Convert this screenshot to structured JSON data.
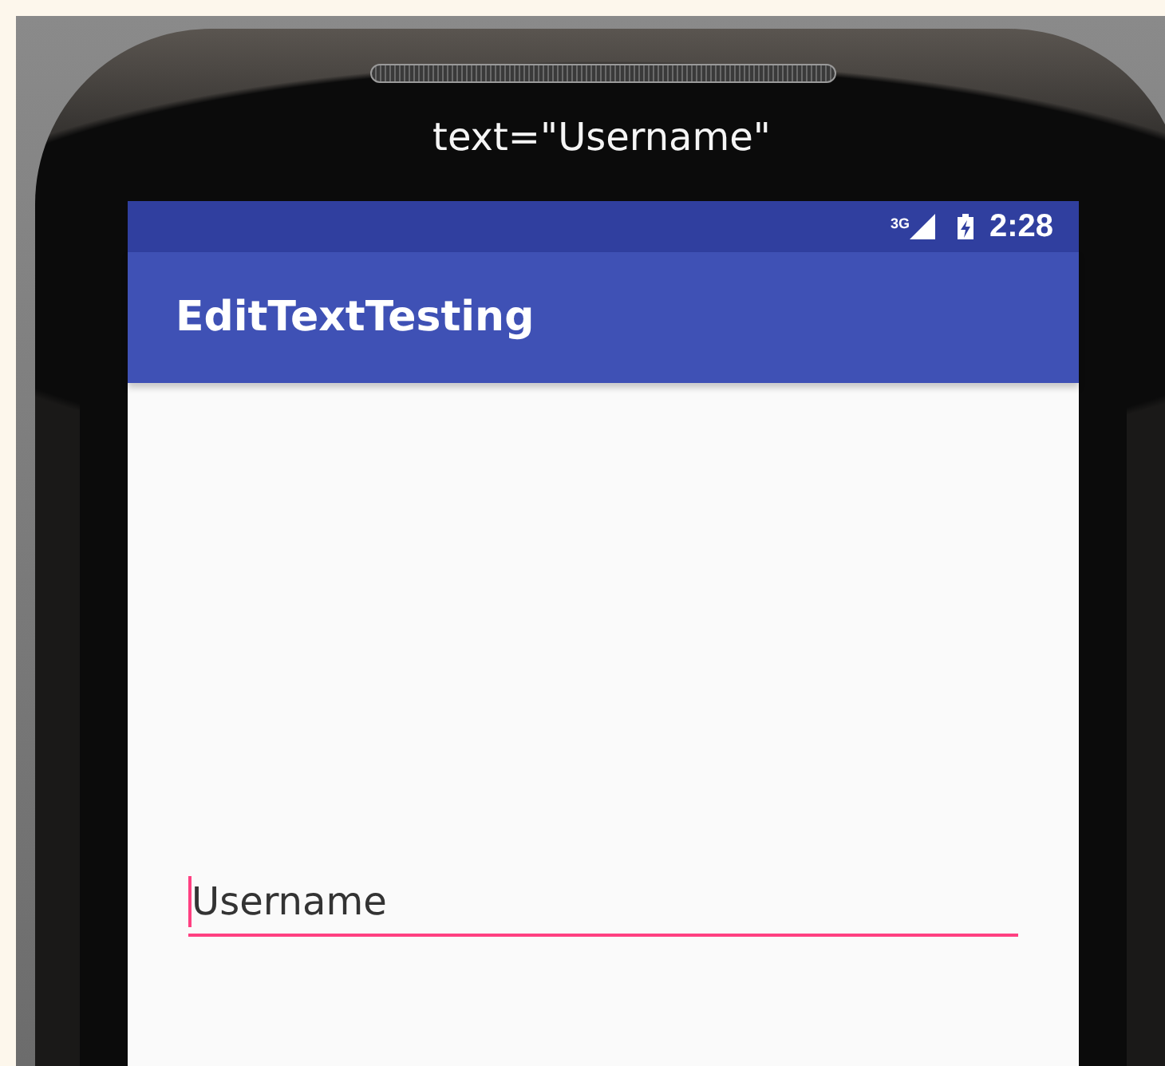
{
  "caption": "text=\"Username\"",
  "status_bar": {
    "network": "3G",
    "time": "2:28"
  },
  "app_bar": {
    "title": "EditTextTesting"
  },
  "edit_text": {
    "value": "Username",
    "focused": true
  }
}
